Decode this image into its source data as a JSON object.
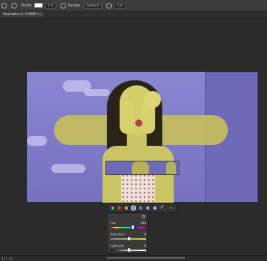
{
  "toolbar": {
    "tool1_label": "Mode:",
    "tool1_value": "1 st",
    "tool2_label": "Nudge",
    "tool3_label": "Subtract",
    "tool4_label": "3 px"
  },
  "document": {
    "tab_title": "Illustration 1, RGB/8*) ×"
  },
  "adjustment_panel": {
    "hue_label": "Hue",
    "hue_value": "+24",
    "hue_level": 0.6,
    "saturation_label": "Saturation",
    "saturation_value": "0",
    "saturation_level": 0.5,
    "lightness_label": "Lightness",
    "lightness_value": "0",
    "lightness_level": 0.5,
    "more_label": "•••",
    "swatches": [
      "#8f6ad8",
      "#c94a3b",
      "#e0a030",
      "#5b8ad8",
      "#6a7fd0",
      "#9aa3e0",
      "#a7a7f0"
    ]
  },
  "status": {
    "text": "1 / 1 art"
  }
}
